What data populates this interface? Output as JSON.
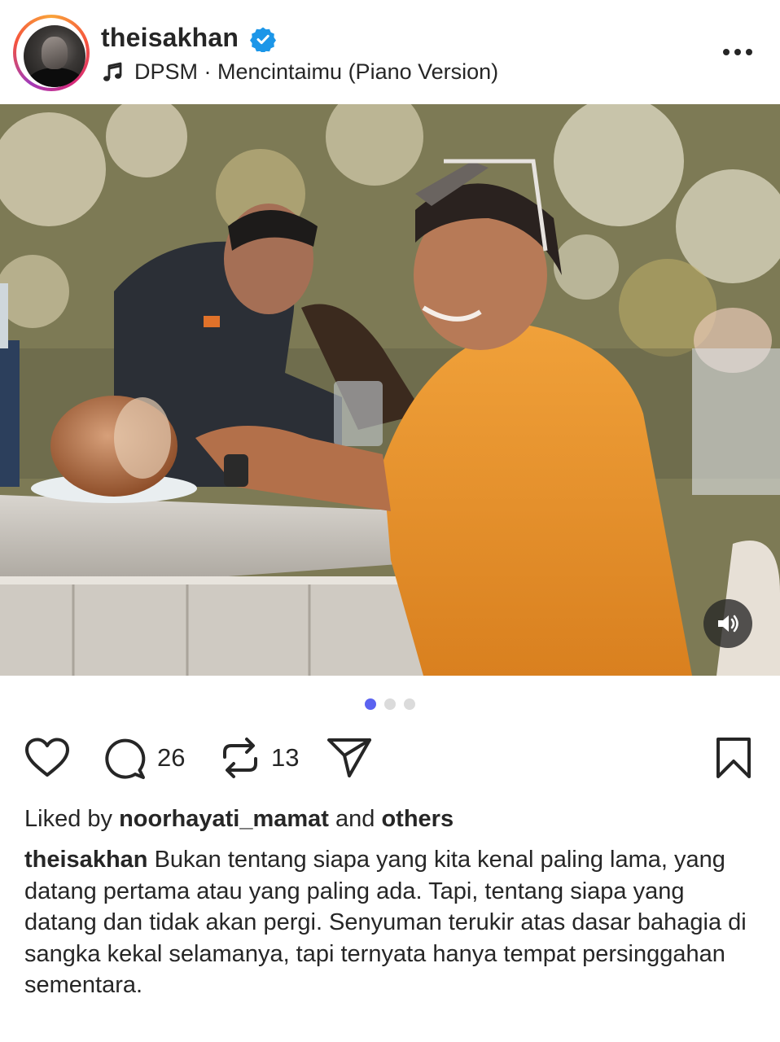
{
  "post": {
    "username": "theisakhan",
    "verified": true,
    "audio": "DPSM · Mencintaimu (Piano Version)",
    "carousel": {
      "total": 3,
      "current": 1
    },
    "accent_color": "#5b63f0",
    "actions": {
      "like_icon": "heart-icon",
      "comment_icon": "comment-icon",
      "comment_count": "26",
      "repost_icon": "repost-icon",
      "repost_count": "13",
      "share_icon": "share-icon",
      "save_icon": "bookmark-icon"
    },
    "likes": {
      "prefix": "Liked by",
      "user": "noorhayati_mamat",
      "joiner": "and",
      "others": "others"
    },
    "caption": {
      "user": "theisakhan",
      "text": "Bukan tentang siapa yang kita kenal paling lama, yang datang pertama atau yang paling ada. Tapi, tentang siapa yang datang dan tidak akan pergi. Senyuman terukir atas dasar bahagia di sangka kekal selamanya, tapi ternyata hanya tempat persinggahan sementara."
    }
  }
}
